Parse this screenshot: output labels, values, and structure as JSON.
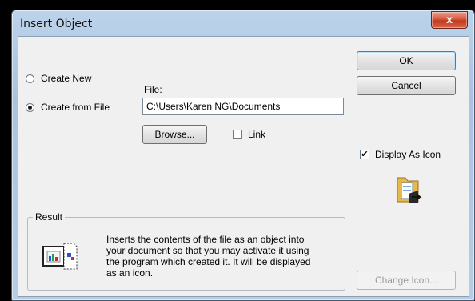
{
  "window": {
    "title": "Insert Object",
    "close_glyph": "x"
  },
  "options": {
    "create_new_label": "Create New",
    "create_from_file_label": "Create from File",
    "selected": "create_from_file"
  },
  "file": {
    "label": "File:",
    "value": "C:\\Users\\Karen NG\\Documents",
    "browse_label": "Browse...",
    "link_label": "Link",
    "link_checked": false
  },
  "buttons": {
    "ok": "OK",
    "cancel": "Cancel",
    "change_icon": "Change Icon..."
  },
  "display_as_icon": {
    "label": "Display As Icon",
    "checked": true,
    "check_glyph": "✔"
  },
  "result": {
    "legend": "Result",
    "lines": [
      "Inserts the contents of the file as an object into",
      "your document so that you may activate it using",
      "the program which created it. It will be displayed",
      "as an icon."
    ]
  },
  "icons": {
    "result_icon": "chart-document-icon",
    "preview_icon": "folder-document-icon"
  }
}
